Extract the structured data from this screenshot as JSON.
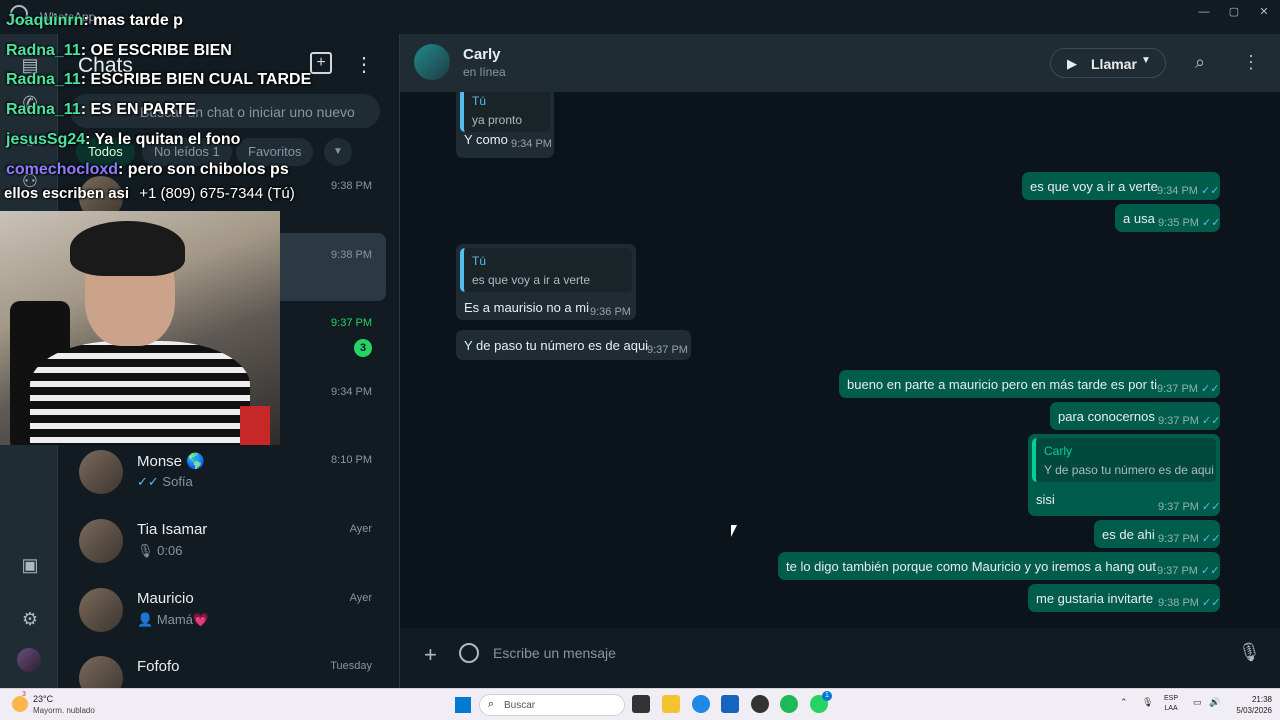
{
  "window": {
    "app_name": "WhatsApp",
    "min": "—",
    "max": "▢",
    "close": "✕"
  },
  "colors": {
    "accent": "#25d366",
    "outgoing": "#005c4b",
    "incoming": "#202c33",
    "background": "#0b141a"
  },
  "sidebar": {
    "title": "Chats",
    "search_placeholder": "Buscar un chat o iniciar uno nuevo",
    "filters": [
      "Todos",
      "No leídos 1",
      "Favoritos"
    ],
    "chats": [
      {
        "name": "",
        "sub": "",
        "time": "9:38 PM"
      },
      {
        "name": "",
        "sub": "",
        "time": "9:38 PM",
        "selected": true
      },
      {
        "name": "",
        "sub": "",
        "time": "9:37 PM",
        "unread": 3
      },
      {
        "name": "",
        "sub": "",
        "time": "9:34 PM"
      },
      {
        "name": "Monse 🌎",
        "sub_tick": "✓✓",
        "sub": "Sofía",
        "time": "8:10 PM"
      },
      {
        "name": "Tia Isamar",
        "sub_icon": "🎙",
        "sub": "0:06",
        "time": "Ayer"
      },
      {
        "name": "Mauricio",
        "sub_icon": "👤",
        "sub": "Mamá💗",
        "time": "Ayer"
      },
      {
        "name": "Fofofo",
        "sub": "",
        "time": "Tuesday"
      }
    ],
    "rail_icons": [
      "chats-icon",
      "calls-icon",
      "status-icon",
      "communities-icon",
      "media-icon",
      "settings-icon"
    ]
  },
  "conversation": {
    "contact_name": "Carly",
    "contact_status": "en línea",
    "call_label": "Llamar",
    "composer_placeholder": "Escribe un mensaje",
    "messages": [
      {
        "dir": "in",
        "quote_name": "Tú",
        "quote_text": "ya pronto",
        "text": "Y como",
        "time": "9:34 PM"
      },
      {
        "dir": "out",
        "text": "es que voy a ir a verte",
        "time": "9:34 PM",
        "ticks": "✓✓"
      },
      {
        "dir": "out",
        "text": "a usa",
        "time": "9:35 PM",
        "ticks": "✓✓"
      },
      {
        "dir": "in",
        "quote_name": "Tú",
        "quote_text": "es que voy a ir a verte",
        "text": "Es a maurisio no a mi",
        "time": "9:36 PM"
      },
      {
        "dir": "in",
        "text": "Y de paso tu número es de aqui",
        "time": "9:37 PM"
      },
      {
        "dir": "out",
        "text": "bueno en parte a mauricio pero en más tarde es por ti",
        "time": "9:37 PM",
        "ticks": "✓✓"
      },
      {
        "dir": "out",
        "text": "para conocernos",
        "time": "9:37 PM",
        "ticks": "✓✓"
      },
      {
        "dir": "out",
        "quote_name": "Carly",
        "quote_text": "Y de paso tu número es de aqui",
        "text": "sisi",
        "time": "9:37 PM",
        "ticks": "✓✓"
      },
      {
        "dir": "out",
        "text": "es de ahi",
        "time": "9:37 PM",
        "ticks": "✓✓"
      },
      {
        "dir": "out",
        "text": "te lo digo también porque como Mauricio y yo iremos a hang out",
        "time": "9:37 PM",
        "ticks": "✓✓"
      },
      {
        "dir": "out",
        "text": "me gustaria invitarte",
        "time": "9:38 PM",
        "ticks": "✓✓"
      }
    ]
  },
  "stream_chat": [
    {
      "user": "Joaquinrn",
      "msg": ": mas tarde p"
    },
    {
      "user": "Radna_11",
      "msg": ": OE ESCRIBE BIEN"
    },
    {
      "user": "Radna_11",
      "msg": ": ESCRIBE BIEN CUAL TARDE"
    },
    {
      "user": "Radna_11",
      "msg": ": ES EN PARTE"
    },
    {
      "user": "jesusSg24",
      "msg": ": Ya le quitan el fono"
    },
    {
      "user": "comechocloxd",
      "msg": ": pero son chibolos ps"
    },
    {
      "user": "",
      "msg": "ellos escriben asi"
    }
  ],
  "sidebar_overlay_text": "+1 (809) 675-7344 (Tú)",
  "taskbar": {
    "weather_temp": "23°C",
    "weather_desc": "Mayorm. nublado",
    "weather_badge": "3",
    "search_placeholder": "Buscar",
    "lang_top": "ESP",
    "lang_bottom": "LAA",
    "time": "21:38",
    "date": "5/03/2026",
    "whatsapp_badge": "1"
  }
}
